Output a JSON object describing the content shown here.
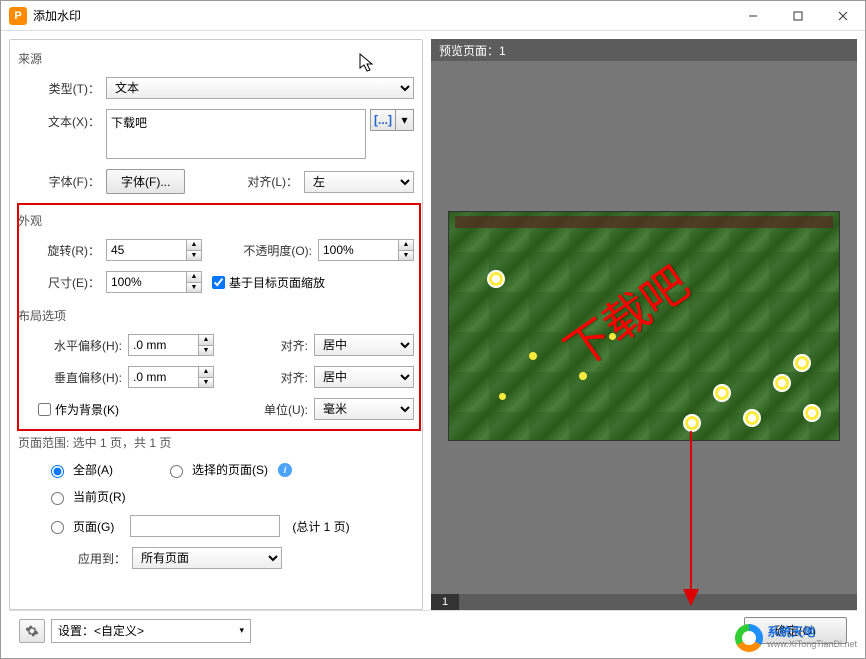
{
  "window": {
    "title": "添加水印"
  },
  "panels": {
    "source": {
      "title": "来源",
      "type_label": "类型(T)：",
      "type_value": "文本",
      "text_label": "文本(X)：",
      "text_value": "下载吧",
      "font_label": "字体(F)：",
      "font_button": "字体(F)...",
      "align_label": "对齐(L)：",
      "align_value": "左",
      "macro_btn": "[...]"
    },
    "appearance": {
      "title": "外观",
      "rotate_label": "旋转(R)：",
      "rotate_value": "45",
      "opacity_label": "不透明度(O):",
      "opacity_value": "100%",
      "size_label": "尺寸(E)：",
      "size_value": "100%",
      "scale_checkbox": "基于目标页面缩放"
    },
    "layout": {
      "title": "布局选项",
      "hoffset_label": "水平偏移(H):",
      "hoffset_value": ".0 mm",
      "voffset_label": "垂直偏移(H):",
      "voffset_value": ".0 mm",
      "align1_label": "对齐:",
      "align1_value": "居中",
      "align2_label": "对齐:",
      "align2_value": "居中",
      "unit_label": "单位(U):",
      "unit_value": "毫米",
      "as_bg_label": "作为背景(K)"
    },
    "page_range": {
      "title": "页面范围: 选中 1 页，共 1 页",
      "all_label": "全部(A)",
      "selected_label": "选择的页面(S)",
      "current_label": "当前页(R)",
      "pages_label": "页面(G)",
      "pages_total": "(总计 1 页)",
      "apply_label": "应用到：",
      "apply_value": "所有页面"
    }
  },
  "preview": {
    "header": "预览页面：1",
    "watermark": "下载吧",
    "page": "1"
  },
  "footer": {
    "settings_label": "设置：<自定义>",
    "ok": "确定(O)"
  },
  "branding": {
    "line1": "系统天地",
    "line2": "www.XiTongTianDi.net"
  }
}
